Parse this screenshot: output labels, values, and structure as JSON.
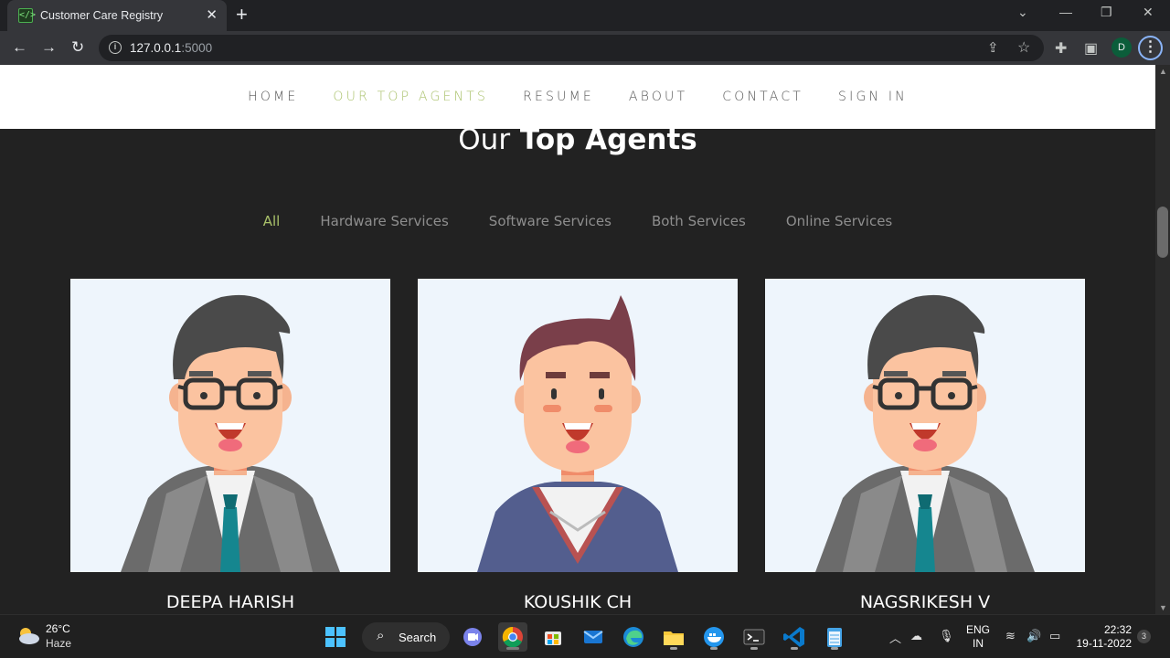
{
  "browser": {
    "tab_title": "Customer Care Registry",
    "url_host": "127.0.0.1",
    "url_port": ":5000",
    "profile_initial": "D"
  },
  "site_nav": {
    "items": [
      {
        "label": "HOME",
        "active": false
      },
      {
        "label": "OUR TOP AGENTS",
        "active": true
      },
      {
        "label": "RESUME",
        "active": false
      },
      {
        "label": "ABOUT",
        "active": false
      },
      {
        "label": "CONTACT",
        "active": false
      },
      {
        "label": "SIGN IN",
        "active": false
      }
    ]
  },
  "section": {
    "heading_light": "Our",
    "heading_bold": "Top Agents",
    "filters": [
      "All",
      "Hardware Services",
      "Software Services",
      "Both Services",
      "Online Services"
    ],
    "active_filter": "All"
  },
  "agents": [
    {
      "name": "DEEPA HARISH",
      "avatar": "glasses-suit-avatar"
    },
    {
      "name": "KOUSHIK CH",
      "avatar": "sweater-avatar"
    },
    {
      "name": "NAGSRIKESH V",
      "avatar": "glasses-suit-avatar"
    }
  ],
  "taskbar": {
    "temperature": "26°C",
    "condition": "Haze",
    "search_label": "Search",
    "lang_line1": "ENG",
    "lang_line2": "IN",
    "time": "22:32",
    "date": "19-11-2022",
    "notification_count": "3"
  },
  "colors": {
    "accent": "#a9c16a",
    "page_bg": "#222222",
    "card_bg": "#eef5fc"
  }
}
